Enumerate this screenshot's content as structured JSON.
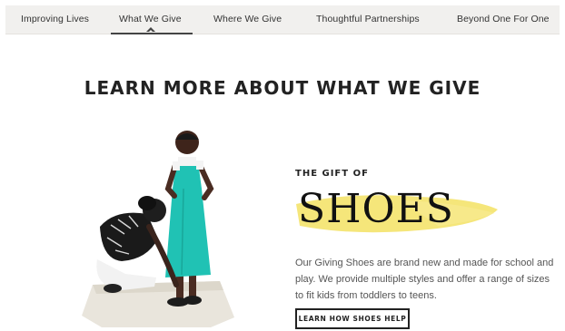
{
  "nav": {
    "items": [
      {
        "label": "Improving Lives"
      },
      {
        "label": "What We Give",
        "active": true
      },
      {
        "label": "Where We Give"
      },
      {
        "label": "Thoughtful Partnerships"
      },
      {
        "label": "Beyond One For One"
      }
    ]
  },
  "main": {
    "heading": "LEARN MORE ABOUT WHAT WE GIVE",
    "eyebrow": "THE GIFT OF",
    "title": "SHOES",
    "description": "Our Giving Shoes are brand new and made for school and play. We provide multiple styles and offer a range of sizes to fit kids from toddlers to teens.",
    "cta_label": "LEARN HOW SHOES HELP"
  },
  "colors": {
    "nav_bg": "#f1f0ee",
    "highlight": "#f4e36b",
    "dress": "#20c2b4"
  },
  "icons": {
    "active_indicator": "caret-up-icon"
  }
}
